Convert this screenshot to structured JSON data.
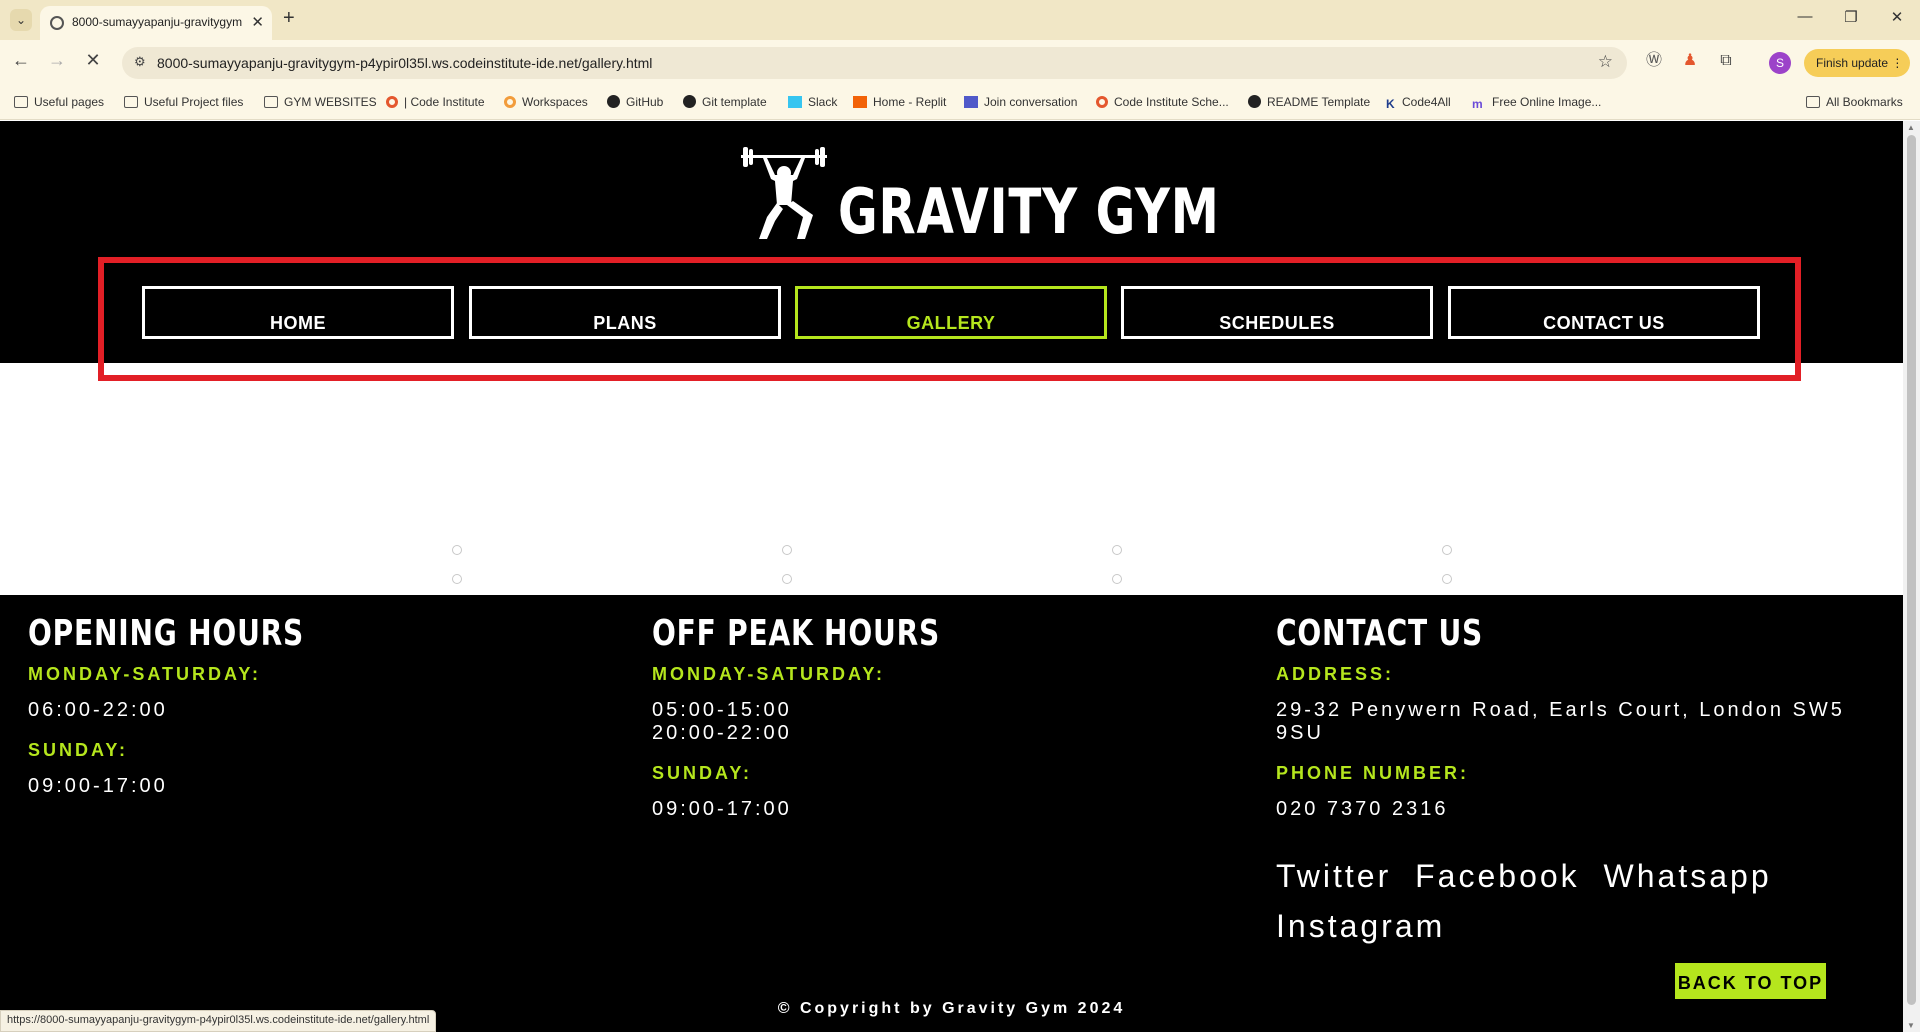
{
  "browser": {
    "tab_title": "8000-sumayyapanju-gravitygym-p4ypir0l35l",
    "url": "8000-sumayyapanju-gravitygym-p4ypir0l35l.ws.codeinstitute-ide.net/gallery.html",
    "finish_update": "Finish update",
    "profile_initial": "S",
    "bookmarks": [
      "Useful pages",
      "Useful Project files",
      "GYM WEBSITES",
      "| Code Institute",
      "Workspaces",
      "GitHub",
      "Git template",
      "Slack",
      "Home - Replit",
      "Join conversation",
      "Code Institute Sche...",
      "README Template",
      "Code4All",
      "Free Online Image...",
      "All Bookmarks"
    ],
    "status_url": "https://8000-sumayyapanju-gravitygym-p4ypir0l35l.ws.codeinstitute-ide.net/gallery.html"
  },
  "site": {
    "brand": "GRAVITY GYM",
    "nav": [
      "HOME",
      "PLANS",
      "GALLERY",
      "SCHEDULES",
      "CONTACT US"
    ],
    "active_nav": "GALLERY",
    "accent_color": "#b5e61d",
    "highlight_color": "#e21f26"
  },
  "footer": {
    "opening": {
      "heading": "OPENING HOURS",
      "label1": "MONDAY-SATURDAY:",
      "value1": "06:00-22:00",
      "label2": "SUNDAY:",
      "value2": "09:00-17:00"
    },
    "offpeak": {
      "heading": "OFF PEAK HOURS",
      "label1": "MONDAY-SATURDAY:",
      "value1a": "05:00-15:00",
      "value1b": "20:00-22:00",
      "label2": "SUNDAY:",
      "value2": "09:00-17:00"
    },
    "contact": {
      "heading": "CONTACT US",
      "address_label": "ADDRESS:",
      "address": "29-32 Penywern Road, Earls Court, London SW5 9SU",
      "phone_label": "PHONE NUMBER:",
      "phone": "020 7370 2316",
      "social": [
        "Twitter",
        "Facebook",
        "Whatsapp",
        "Instagram"
      ]
    },
    "copyright": "© Copyright by Gravity Gym 2024",
    "back_to_top": "BACK TO TOP"
  }
}
